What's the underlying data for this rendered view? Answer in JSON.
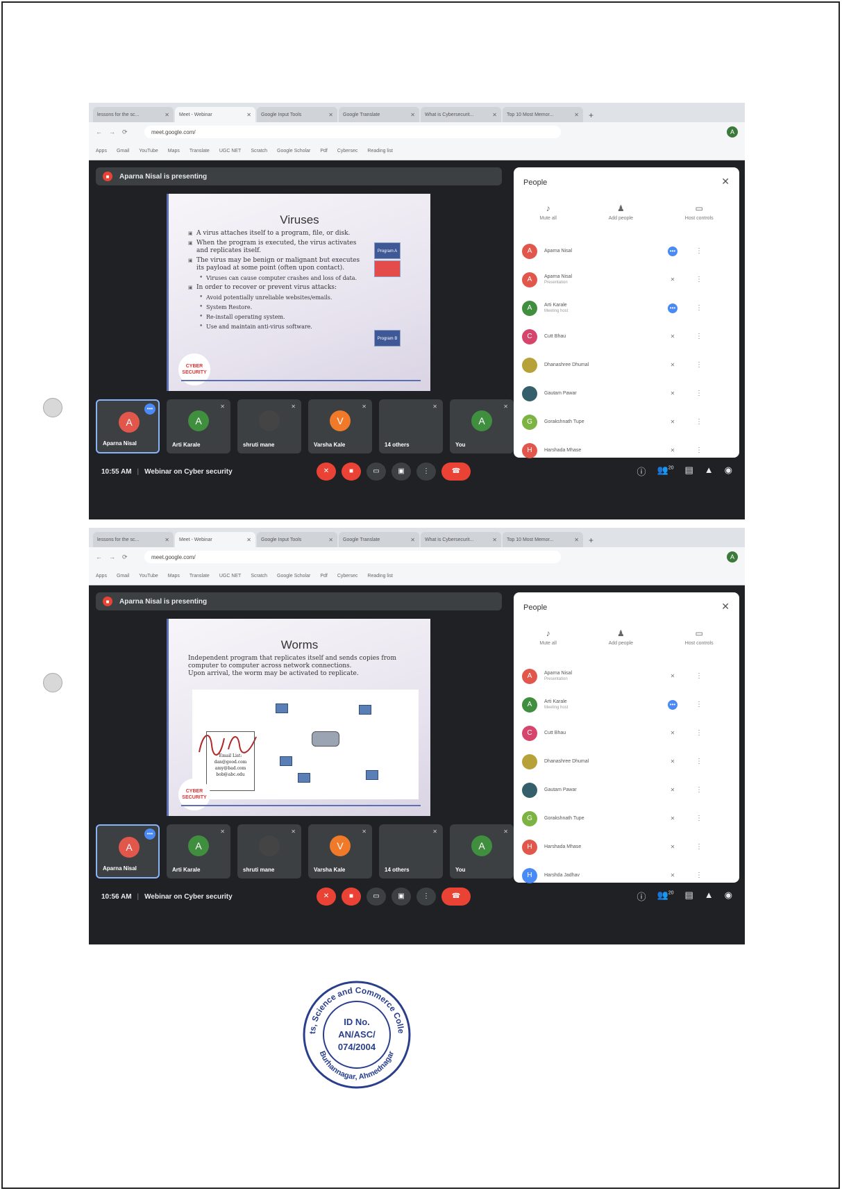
{
  "browser": {
    "tabs": [
      "lessons for the sc...",
      "Meet - Webinar",
      "Google Input Tools",
      "Google Translate",
      "What is Cybersecurit...",
      "Top 10 Most Memor..."
    ],
    "url": "meet.google.com/",
    "bookmarks": [
      "Apps",
      "Gmail",
      "YouTube",
      "Maps",
      "Translate",
      "UGC NET",
      "Scratch",
      "Google Scholar",
      "Pdf",
      "Cybersec",
      "Reading list"
    ]
  },
  "screenshots": [
    {
      "presenting_label": "Aparna Nisal is presenting",
      "slide": {
        "title": "Viruses",
        "bullets": [
          {
            "text": "A virus attaches itself to a program, file, or disk.",
            "sub": false
          },
          {
            "text": "When the program is executed, the virus activates and replicates itself.",
            "sub": false
          },
          {
            "text": "The virus may be benign or malignant but executes its payload at some point (often upon contact).",
            "sub": false
          },
          {
            "text": "Viruses can cause computer crashes and loss of data.",
            "sub": true
          },
          {
            "text": "In order to recover or prevent virus attacks:",
            "sub": false
          },
          {
            "text": "Avoid potentially unreliable websites/emails.",
            "sub": true
          },
          {
            "text": "System Restore.",
            "sub": true
          },
          {
            "text": "Re-install operating system.",
            "sub": true
          },
          {
            "text": "Use and maintain anti-virus software.",
            "sub": true
          }
        ],
        "program_labels": [
          "Program A",
          "Program B"
        ],
        "badge": "CYBER SECURITY"
      },
      "tiles": [
        {
          "initial": "A",
          "name": "Aparna Nisal",
          "color": "#e2574c",
          "active": true
        },
        {
          "initial": "A",
          "name": "Arti Karale",
          "color": "#3f8f3f",
          "active": false
        },
        {
          "initial": "",
          "name": "shruti mane",
          "color": "#444444",
          "active": false
        },
        {
          "initial": "V",
          "name": "Varsha Kale",
          "color": "#f07a2a",
          "active": false
        },
        {
          "initial": "",
          "name": "14 others",
          "color": "#3c4043",
          "active": false
        },
        {
          "initial": "A",
          "name": "You",
          "color": "#3f8f3f",
          "active": false
        }
      ],
      "time": "10:55 AM",
      "meeting": "Webinar on Cyber security",
      "people_count": "20",
      "people": [
        {
          "initial": "A",
          "name": "Aparna Nisal",
          "sub": "",
          "color": "#e2574c",
          "speaking": true
        },
        {
          "initial": "A",
          "name": "Aparna Nisal",
          "sub": "Presentation",
          "color": "#e2574c",
          "speaking": false
        },
        {
          "initial": "A",
          "name": "Arti Karale",
          "sub": "Meeting host",
          "color": "#3f8f3f",
          "speaking": true
        },
        {
          "initial": "C",
          "name": "Cutt Bhau",
          "sub": "",
          "color": "#d5456c",
          "speaking": false
        },
        {
          "initial": "",
          "name": "Dhanashree Dhumal",
          "sub": "",
          "color": "#b7a23a",
          "speaking": false
        },
        {
          "initial": "",
          "name": "Gautam Pawar",
          "sub": "",
          "color": "#35606b",
          "speaking": false
        },
        {
          "initial": "G",
          "name": "Gorakshnath Tupe",
          "sub": "",
          "color": "#7cb342",
          "speaking": false
        },
        {
          "initial": "H",
          "name": "Harshada Mhase",
          "sub": "",
          "color": "#e2574c",
          "speaking": false
        }
      ]
    },
    {
      "presenting_label": "Aparna Nisal is presenting",
      "slide": {
        "title": "Worms",
        "text_lines": [
          "Independent program that replicates itself and sends copies from computer to computer across network connections.",
          "Upon arrival, the worm may be activated to replicate."
        ],
        "email_box": [
          "Email List:",
          "dan@good.com",
          "amy@bad.com",
          "bob@abc.edu"
        ],
        "badge": "CYBER SECURITY"
      },
      "tiles": [
        {
          "initial": "A",
          "name": "Aparna Nisal",
          "color": "#e2574c",
          "active": true
        },
        {
          "initial": "A",
          "name": "Arti Karale",
          "color": "#3f8f3f",
          "active": false
        },
        {
          "initial": "",
          "name": "shruti mane",
          "color": "#444444",
          "active": false
        },
        {
          "initial": "V",
          "name": "Varsha Kale",
          "color": "#f07a2a",
          "active": false
        },
        {
          "initial": "",
          "name": "14 others",
          "color": "#3c4043",
          "active": false
        },
        {
          "initial": "A",
          "name": "You",
          "color": "#3f8f3f",
          "active": false
        }
      ],
      "time": "10:56 AM",
      "meeting": "Webinar on Cyber security",
      "people_count": "20",
      "people": [
        {
          "initial": "A",
          "name": "Aparna Nisal",
          "sub": "Presentation",
          "color": "#e2574c",
          "speaking": false
        },
        {
          "initial": "A",
          "name": "Arti Karale",
          "sub": "Meeting host",
          "color": "#3f8f3f",
          "speaking": true
        },
        {
          "initial": "C",
          "name": "Cutt Bhau",
          "sub": "",
          "color": "#d5456c",
          "speaking": false
        },
        {
          "initial": "",
          "name": "Dhanashree Dhumal",
          "sub": "",
          "color": "#b7a23a",
          "speaking": false
        },
        {
          "initial": "",
          "name": "Gautam Pawar",
          "sub": "",
          "color": "#35606b",
          "speaking": false
        },
        {
          "initial": "G",
          "name": "Gorakshnath Tupe",
          "sub": "",
          "color": "#7cb342",
          "speaking": false
        },
        {
          "initial": "H",
          "name": "Harshada Mhase",
          "sub": "",
          "color": "#e2574c",
          "speaking": false
        },
        {
          "initial": "H",
          "name": "Harshda Jadhav",
          "sub": "",
          "color": "#4a8af4",
          "speaking": false
        }
      ]
    }
  ],
  "panel": {
    "title": "People",
    "actions": [
      "Mute all",
      "Add people",
      "Host controls"
    ]
  },
  "stamp": {
    "ring_top": "Arts, Science and Commerce College",
    "ring_bottom": "Burhannagar, Ahmednagar",
    "id_label": "ID No.",
    "id_line1": "AN/ASC/",
    "id_line2": "074/2004"
  }
}
